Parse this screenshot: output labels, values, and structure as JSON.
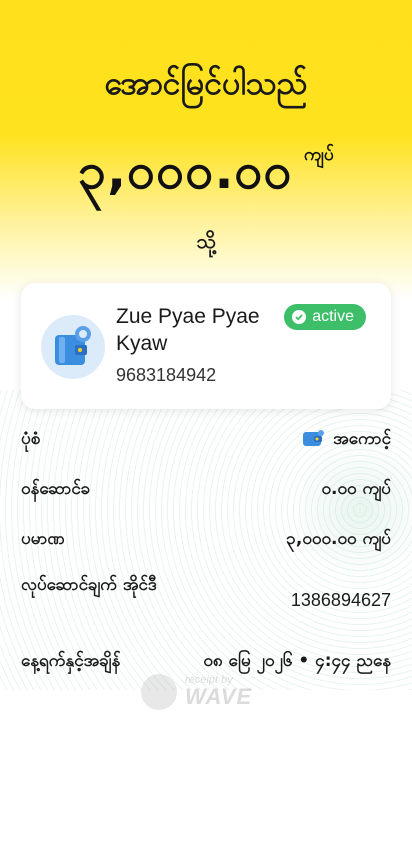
{
  "header": {
    "title": "အောင်မြင်ပါသည်",
    "amount": "၃,၀၀၀.၀၀",
    "currency": "ကျပ်",
    "to_label": "သို့"
  },
  "recipient": {
    "name": "Zue Pyae Pyae Kyaw",
    "phone": "9683184942",
    "status": "active",
    "avatar_icon": "wallet-icon"
  },
  "details": {
    "type_label": "ပုံစံ",
    "type_value": "အကောင့်",
    "fee_label": "ဝန်ဆောင်ခ",
    "fee_value": "၀.၀၀ ကျပ်",
    "total_label": "ပမာဏ",
    "total_value": "၃,၀၀၀.၀၀ ကျပ်",
    "transaction_id_label": "လုပ်ဆောင်ချက် အိုင်ဒီ",
    "transaction_id_value": "1386894627",
    "datetime_label": "နေ့ရက်နှင့်အချိန်",
    "datetime_value": "၀၈ မြေ ၂၀၂၆ • ၄:၄၄ ညနေ"
  },
  "footer": {
    "small_text": "receipt by",
    "brand": "WAVE"
  },
  "colors": {
    "brand_yellow": "#ffe01b",
    "status_green": "#3dbf6a",
    "avatar_bg": "#dcebfa",
    "wallet_blue": "#3b8de0"
  }
}
